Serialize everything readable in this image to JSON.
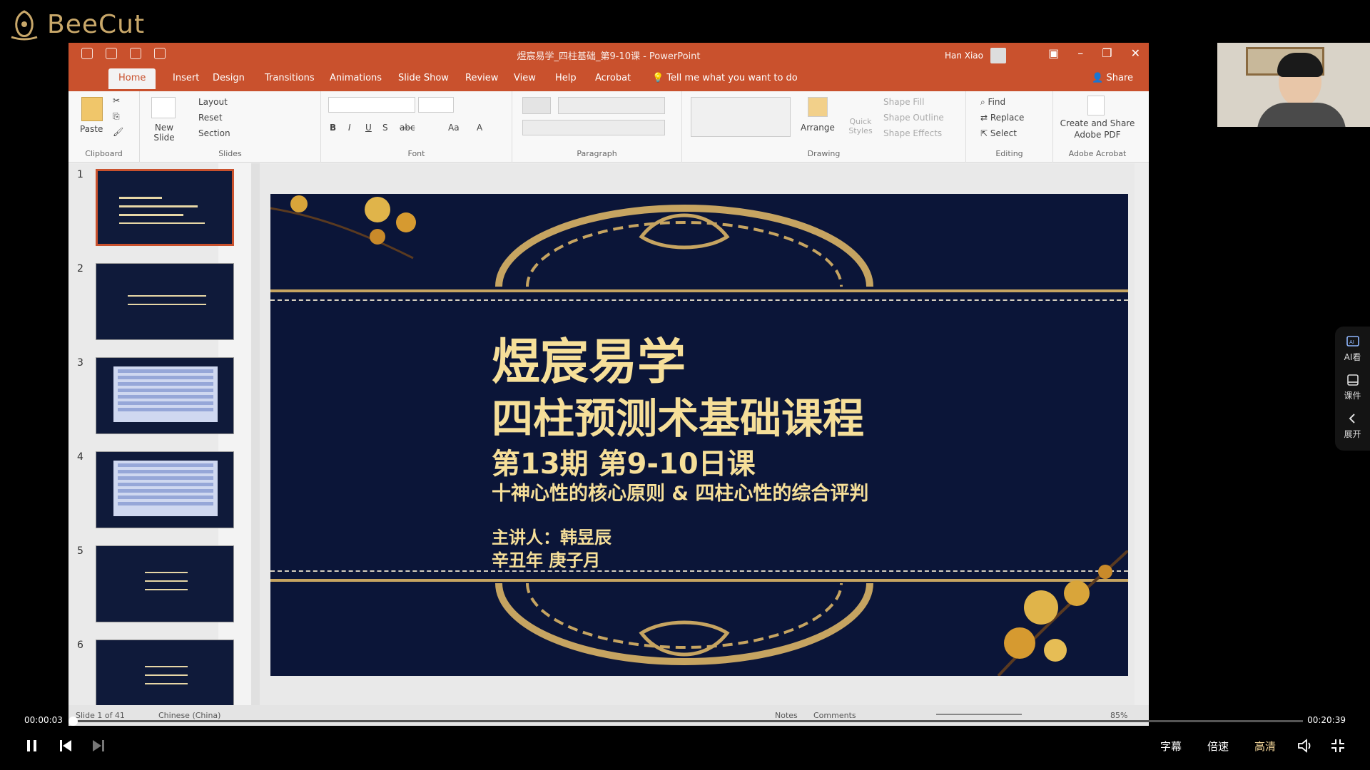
{
  "app": {
    "logo_text": "BeeCut"
  },
  "ppt": {
    "document_title": "煜宸易学_四柱基础_第9-10课 - PowerPoint",
    "user": "Han Xiao",
    "tabs": [
      "Home",
      "Insert",
      "Design",
      "Transitions",
      "Animations",
      "Slide Show",
      "Review",
      "View",
      "Help",
      "Acrobat"
    ],
    "tell_me": "Tell me what you want to do",
    "share": "Share",
    "ribbon": {
      "clipboard": {
        "paste": "Paste",
        "label": "Clipboard"
      },
      "slides": {
        "new_slide": "New Slide",
        "layout": "Layout",
        "reset": "Reset",
        "section": "Section",
        "label": "Slides"
      },
      "font": {
        "label": "Font"
      },
      "paragraph": {
        "label": "Paragraph"
      },
      "drawing": {
        "arrange": "Arrange",
        "quick_styles": "Quick Styles",
        "shape_fill": "Shape Fill",
        "shape_outline": "Shape Outline",
        "shape_effects": "Shape Effects",
        "label": "Drawing"
      },
      "editing": {
        "find": "Find",
        "replace": "Replace",
        "select": "Select",
        "label": "Editing"
      },
      "acrobat": {
        "create_share": "Create and Share",
        "adobe_pdf": "Adobe PDF",
        "label": "Adobe Acrobat"
      }
    },
    "thumb_numbers": [
      "1",
      "2",
      "3",
      "4",
      "5",
      "6"
    ],
    "slide": {
      "title": "煜宸易学",
      "subtitle": "四柱预测术基础课程",
      "session": "第13期 第9-10日课",
      "topic": "十神心性的核心原则 & 四柱心性的综合评判",
      "lecturer": "主讲人：韩昱辰",
      "date": "辛丑年 庚子月"
    },
    "status": {
      "slide_count": "Slide 1 of 41",
      "language": "Chinese (China)",
      "notes": "Notes",
      "comments": "Comments",
      "zoom": "85%"
    }
  },
  "side_panel": {
    "ai": "AI看",
    "courseware": "课件",
    "expand": "展开"
  },
  "player": {
    "time_current": "00:00:03",
    "time_total": "00:20:39",
    "progress_fraction": 0.0024,
    "subtitles": "字幕",
    "speed": "倍速",
    "quality": "高清"
  },
  "colors": {
    "ppt_accent": "#c9512d",
    "slide_bg": "#0b1538",
    "slide_text": "#f6df99",
    "gold": "#c6a461"
  }
}
